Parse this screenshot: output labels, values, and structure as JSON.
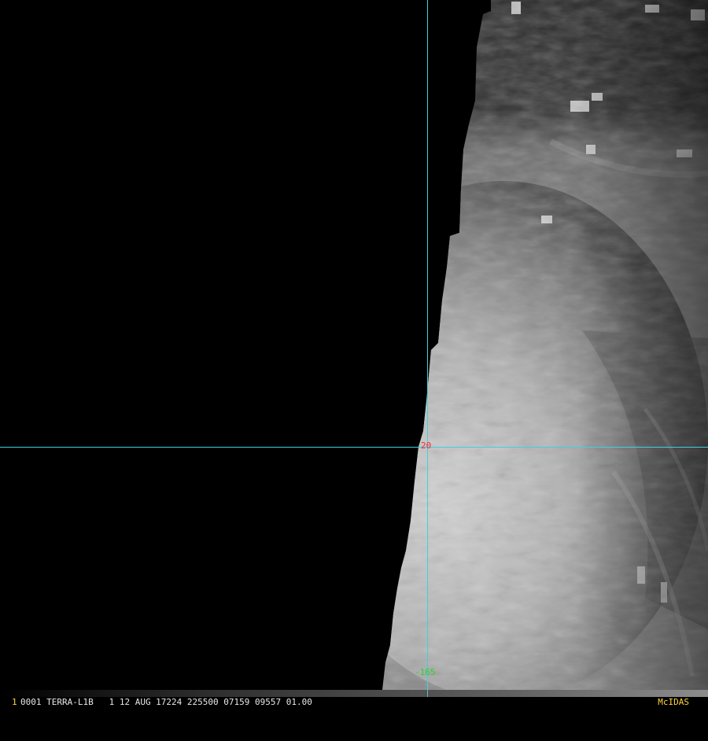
{
  "image": {
    "kind": "satellite-imagery",
    "cloud_colors": {
      "bright": "#d6d6d6",
      "mid": "#8f8f8f",
      "dark": "#3a3a3a",
      "no_data": "#000000"
    }
  },
  "grid": {
    "line_color": "#40d0e0",
    "lat_label": "20",
    "lat_label_color": "#ff2a2a",
    "lon_label": "-165",
    "lon_label_color": "#2ad42a"
  },
  "status_bar": {
    "frame": "1",
    "text": "0001 TERRA-L1B   1 12 AUG 17224 225500 07159 09557 01.00",
    "brand": "McIDAS",
    "accent_color": "#ffd23a"
  }
}
